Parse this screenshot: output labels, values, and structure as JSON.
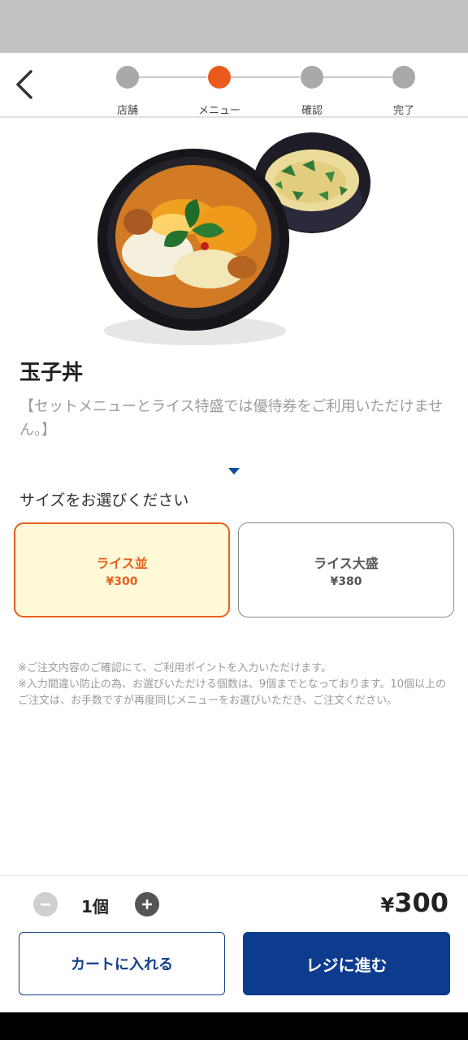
{
  "header": {
    "steps": [
      {
        "label": "店舗",
        "active": false
      },
      {
        "label": "メニュー",
        "active": true
      },
      {
        "label": "確認",
        "active": false
      },
      {
        "label": "完了",
        "active": false
      }
    ]
  },
  "item": {
    "title": "玉子丼",
    "note": "【セットメニューとライス特盛では優待券をご利用いただけません。】"
  },
  "size": {
    "label": "サイズをお選びください",
    "options": [
      {
        "name": "ライス並",
        "price": "¥300",
        "selected": true
      },
      {
        "name": "ライス大盛",
        "price": "¥380",
        "selected": false
      }
    ]
  },
  "notes": [
    "※ご注文内容のご確認にて、ご利用ポイントを入力いただけます。",
    "※入力間違い防止の為、お選びいただける個数は、9個までとなっております。10個以上のご注文は、お手数ですが再度同じメニューをお選びいただき、ご注文ください。"
  ],
  "cart": {
    "quantity": "1個",
    "yen": "¥",
    "amount": "300",
    "add_to_cart_label": "カートに入れる",
    "checkout_label": "レジに進む"
  },
  "colors": {
    "accent": "#ea5a1c",
    "brand_blue": "#0d3b8e",
    "selected_bg": "#fff9d8"
  },
  "icons": {
    "back": "chevron-left-icon",
    "minus": "minus-icon",
    "plus": "plus-icon",
    "expand": "caret-down-icon"
  }
}
